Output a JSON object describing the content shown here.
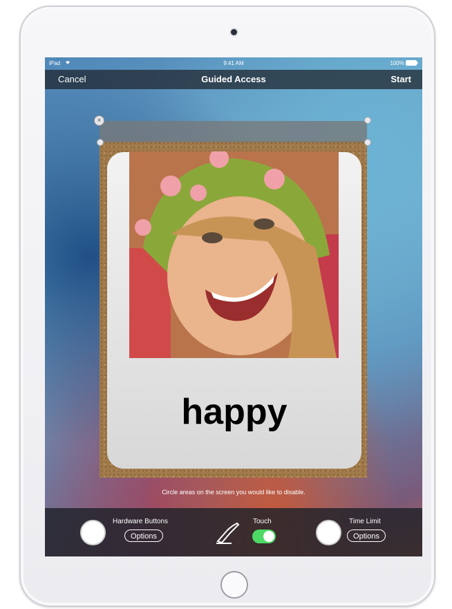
{
  "status": {
    "device": "iPad",
    "wifi_icon": "wifi-icon",
    "time": "9:41 AM",
    "battery": "100%",
    "battery_icon": "battery-icon"
  },
  "nav": {
    "cancel": "Cancel",
    "title": "Guided Access",
    "start": "Start"
  },
  "card": {
    "word": "happy",
    "photo": "laughing girl in polka-dot knit hat"
  },
  "disabled_area": {
    "close_icon": "close-icon"
  },
  "hint": "Circle areas on the screen you would like to disable.",
  "toolbar": {
    "hardware": {
      "label": "Hardware Buttons",
      "options": "Options"
    },
    "touch": {
      "label": "Touch",
      "enabled": true,
      "icon": "hand-pen-icon"
    },
    "time_limit": {
      "label": "Time Limit",
      "options": "Options"
    }
  },
  "colors": {
    "toggle_on": "#4cd964",
    "bar": "#1e222a"
  }
}
